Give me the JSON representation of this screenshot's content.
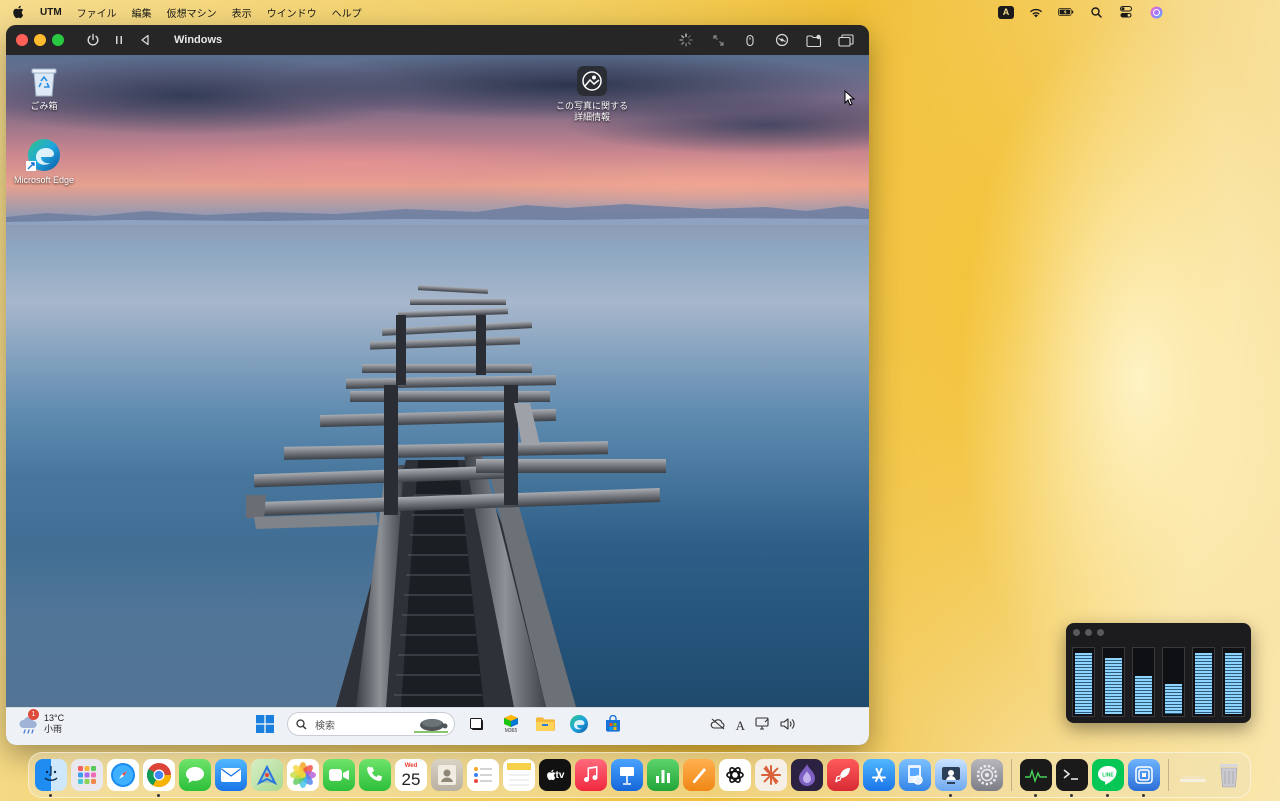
{
  "menubar": {
    "app_name": "UTM",
    "items": [
      "ファイル",
      "編集",
      "仮想マシン",
      "表示",
      "ウインドウ",
      "ヘルプ"
    ],
    "input_mode": "A"
  },
  "vm_window": {
    "title": "Windows"
  },
  "desktop": {
    "icons": [
      {
        "label": "ごみ箱",
        "icon": "recycle-bin-icon"
      },
      {
        "label": "Microsoft Edge",
        "icon": "edge-icon"
      },
      {
        "label": "この写真に関する詳細情報",
        "icon": "photo-info-icon"
      }
    ]
  },
  "taskbar": {
    "weather": {
      "temperature": "13°C",
      "condition": "小雨",
      "badge": "1"
    },
    "search_placeholder": "検索",
    "m365_label": "M365"
  },
  "meter_widget": {
    "levels": [
      0.95,
      0.88,
      0.62,
      0.5,
      0.95,
      0.95
    ]
  },
  "dock": {
    "calendar_month": "Wed",
    "calendar_day": "25",
    "tv_label": "tv",
    "apps": [
      "finder",
      "launchpad",
      "safari",
      "chrome",
      "messages",
      "mail",
      "maps",
      "photos",
      "facetime",
      "phone",
      "calendar",
      "contacts",
      "reminders",
      "notes",
      "apple-tv",
      "music",
      "keynote",
      "numbers",
      "pages",
      "chatgpt",
      "claude",
      "tor",
      "rocket",
      "app-store",
      "preview",
      "utm",
      "system-settings",
      "activity-monitor",
      "terminal",
      "line",
      "cot",
      "downloads",
      "trash"
    ]
  }
}
